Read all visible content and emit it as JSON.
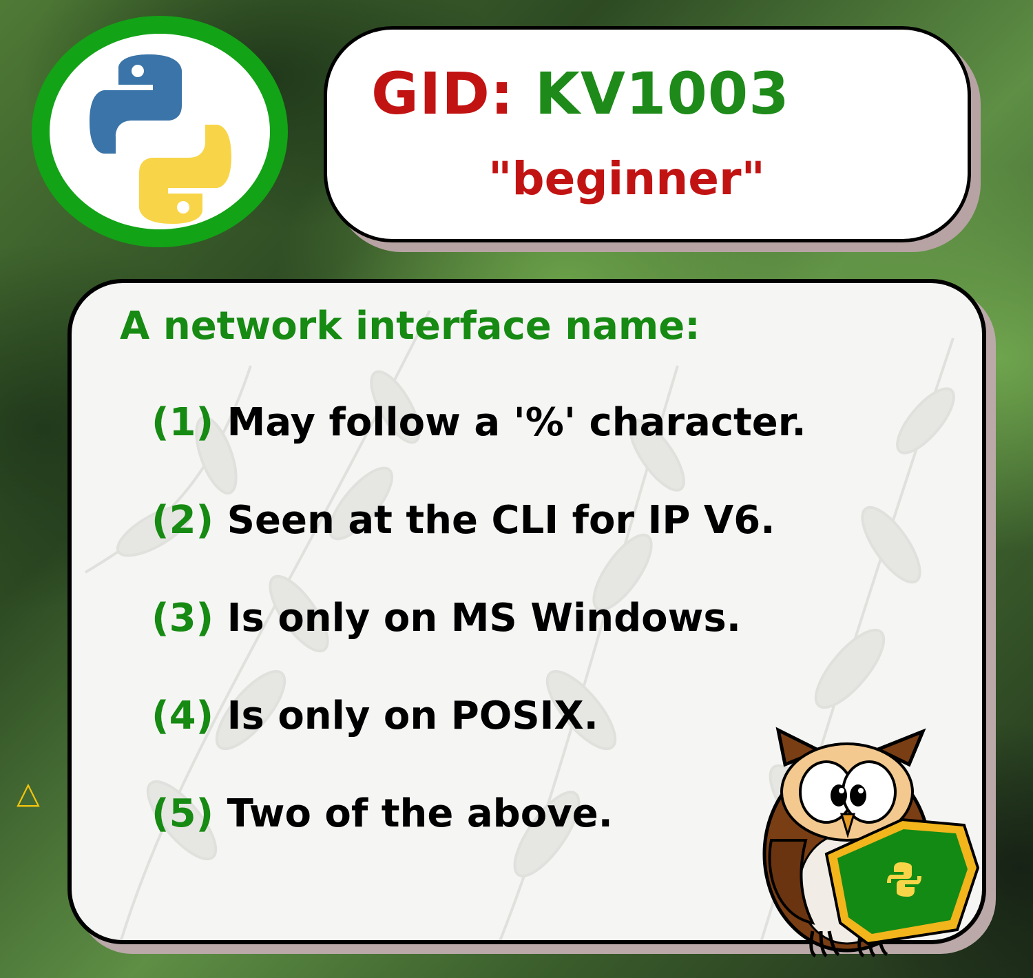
{
  "header": {
    "gid_prefix": "GID:",
    "gid_code": "KV1003",
    "level": "\"beginner\""
  },
  "question": {
    "prompt": "A network interface name:",
    "options": [
      {
        "num": "(1)",
        "text": "May follow a '%' character."
      },
      {
        "num": "(2)",
        "text": "Seen at the CLI for IP V6."
      },
      {
        "num": "(3)",
        "text": "Is only on MS Windows."
      },
      {
        "num": "(4)",
        "text": "Is only on POSIX."
      },
      {
        "num": "(5)",
        "text": "Two of the above."
      }
    ]
  },
  "icons": {
    "logo": "python-logo-icon",
    "mascot": "owl-mascot-icon",
    "corner": "triangle-mark-icon"
  },
  "colors": {
    "title_red": "#c21313",
    "title_green": "#1d8a19",
    "logo_ring_green": "#12a316",
    "python_blue": "#3a74a8",
    "python_yellow": "#f8d548"
  }
}
